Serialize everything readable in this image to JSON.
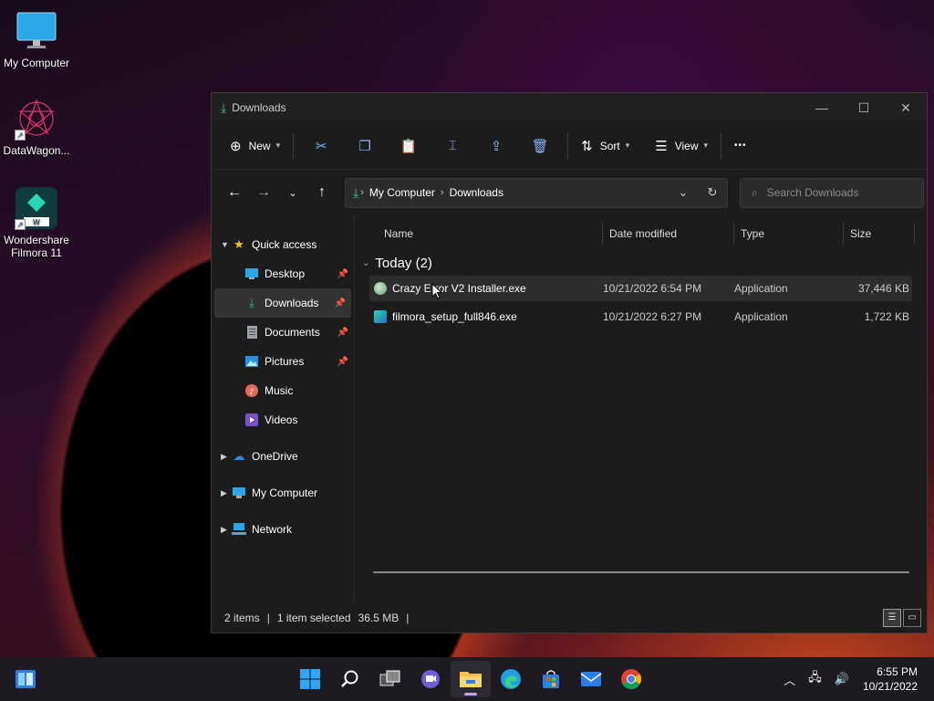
{
  "desktop": {
    "icons": [
      {
        "label": "My Computer"
      },
      {
        "label": "DataWagon..."
      },
      {
        "label": "Wondershare Filmora 11"
      }
    ]
  },
  "window": {
    "title": "Downloads",
    "controls": {
      "minimize": "—",
      "maximize": "☐",
      "close": "✕"
    }
  },
  "toolbar": {
    "new_label": "New",
    "sort_label": "Sort",
    "view_label": "View",
    "more_label": "•••"
  },
  "address": {
    "crumbs": [
      "My Computer",
      "Downloads"
    ]
  },
  "search": {
    "placeholder": "Search Downloads"
  },
  "nav": {
    "quick_access": "Quick access",
    "items": [
      {
        "label": "Desktop",
        "pinned": true,
        "icon": "desktop-icon"
      },
      {
        "label": "Downloads",
        "pinned": true,
        "icon": "download-icon"
      },
      {
        "label": "Documents",
        "pinned": true,
        "icon": "document-icon"
      },
      {
        "label": "Pictures",
        "pinned": true,
        "icon": "picture-icon"
      },
      {
        "label": "Music",
        "pinned": false,
        "icon": "music-icon"
      },
      {
        "label": "Videos",
        "pinned": false,
        "icon": "video-icon"
      }
    ],
    "onedrive": "OneDrive",
    "my_computer": "My Computer",
    "network": "Network"
  },
  "columns": {
    "name": "Name",
    "date": "Date modified",
    "type": "Type",
    "size": "Size"
  },
  "group": {
    "label": "Today (2)"
  },
  "files": [
    {
      "name": "Crazy Error V2 Installer.exe",
      "date": "10/21/2022 6:54 PM",
      "type": "Application",
      "size": "37,446 KB"
    },
    {
      "name": "filmora_setup_full846.exe",
      "date": "10/21/2022 6:27 PM",
      "type": "Application",
      "size": "1,722 KB"
    }
  ],
  "status": {
    "items": "2 items",
    "selected": "1 item selected",
    "selected_size": "36.5 MB"
  },
  "taskbar": {
    "time": "6:55 PM",
    "date": "10/21/2022"
  },
  "colors": {
    "accent": "#8ab4f8",
    "download_green": "#3fbf7f"
  }
}
